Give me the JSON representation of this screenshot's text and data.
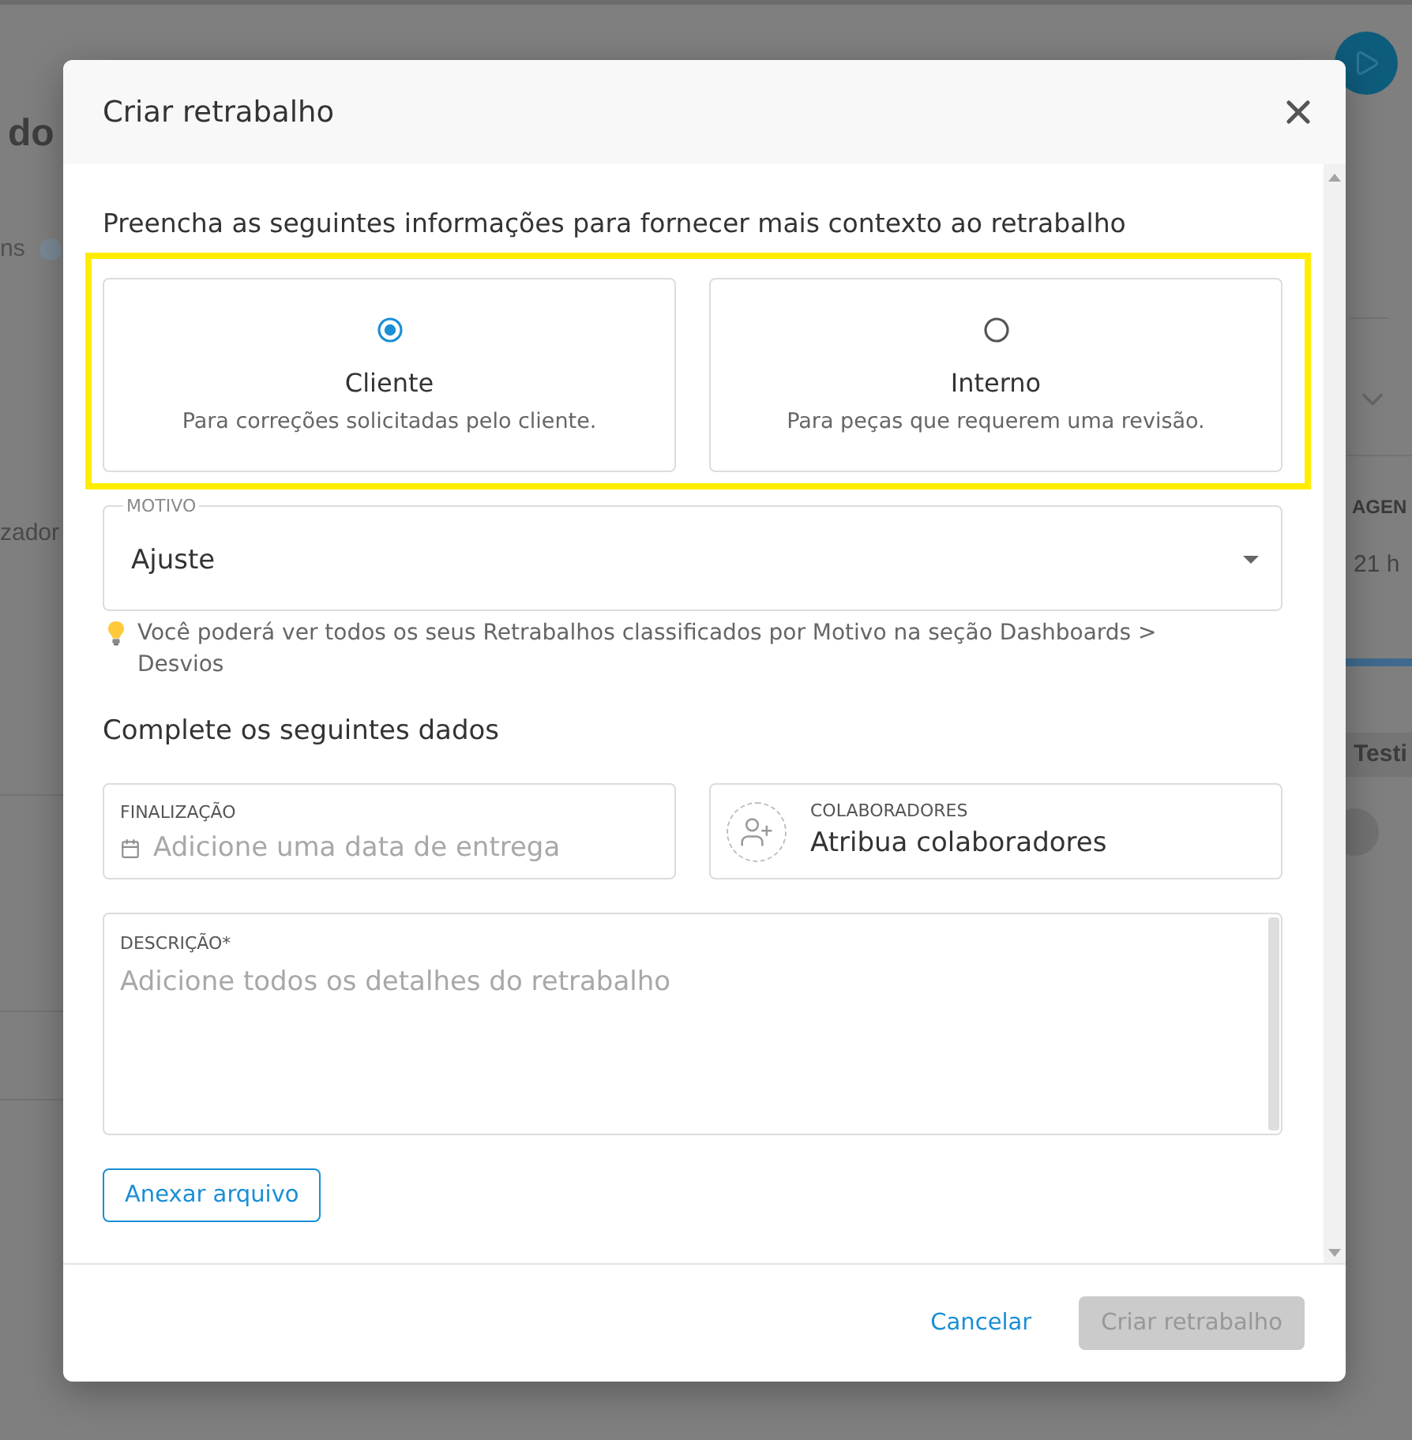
{
  "background": {
    "heading_fragment": "do",
    "tab_fragment": "ns",
    "label_fragment": "zador",
    "column_header_fragment": "AGEN",
    "time_fragment": "21 h",
    "tag_fragment": "Testi"
  },
  "dialog": {
    "title": "Criar retrabalho",
    "intro": "Preencha as seguintes informações para fornecer mais contexto ao retrabalho",
    "options_highlighted": true,
    "options": [
      {
        "label": "Cliente",
        "description": "Para correções solicitadas pelo cliente.",
        "selected": true
      },
      {
        "label": "Interno",
        "description": "Para peças que requerem uma revisão.",
        "selected": false
      }
    ],
    "reason": {
      "label": "MOTIVO",
      "value": "Ajuste"
    },
    "hint": "Você poderá ver todos os seus Retrabalhos classificados por Motivo na seção Dashboards > Desvios",
    "section_title": "Complete os seguintes dados",
    "due_date": {
      "label": "FINALIZAÇÃO",
      "placeholder": "Adicione uma data de entrega"
    },
    "collaborators": {
      "label": "COLABORADORES",
      "value": "Atribua colaboradores"
    },
    "description": {
      "label": "DESCRIÇÃO*",
      "placeholder": "Adicione todos os detalhes do retrabalho"
    },
    "attach_button": "Anexar arquivo",
    "buttons": [
      {
        "label": "Cancelar",
        "kind": "text",
        "disabled": false
      },
      {
        "label": "Criar retrabalho",
        "kind": "filled",
        "disabled": true
      }
    ]
  }
}
